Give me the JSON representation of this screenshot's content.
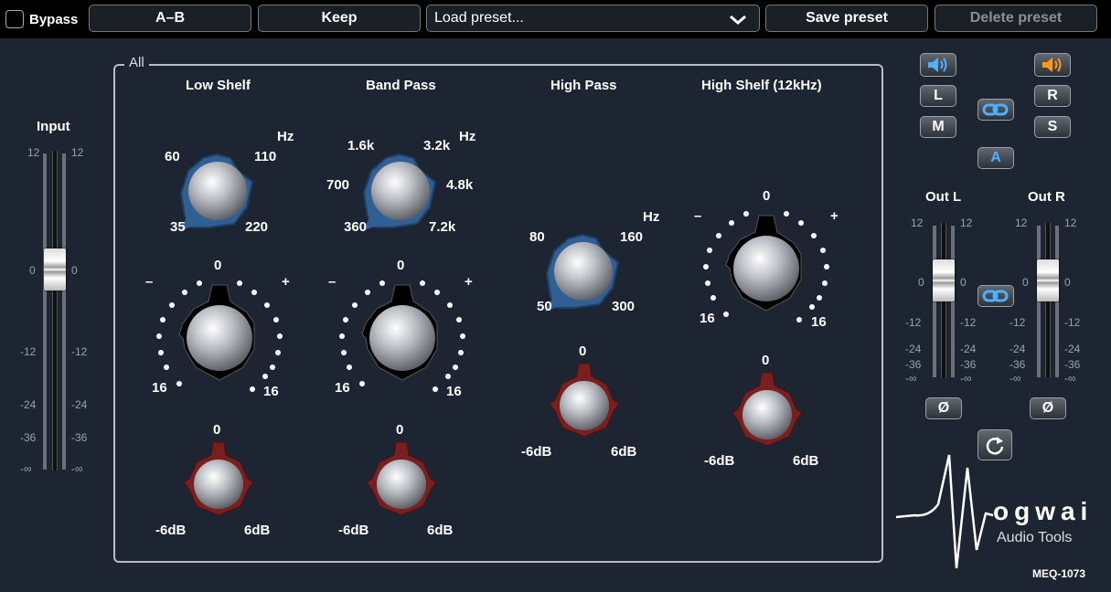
{
  "toolbar": {
    "bypass_label": "Bypass",
    "ab_label": "A–B",
    "keep_label": "Keep",
    "preset_value": "Load preset...",
    "save_label": "Save preset",
    "delete_label": "Delete preset"
  },
  "group": {
    "label": "All"
  },
  "input": {
    "label": "Input",
    "scale": [
      "12",
      "0",
      "-12",
      "-24",
      "-36",
      "-∞"
    ],
    "fader_db": 0
  },
  "bands": {
    "low_shelf": {
      "title": "Low Shelf",
      "unit": "Hz",
      "freqs": [
        "60",
        "110",
        "35",
        "220"
      ],
      "gain_top": "0",
      "gain_minus": "–",
      "gain_plus": "+",
      "gain_min": "16",
      "gain_max": "16",
      "trim_top": "0",
      "trim_min": "-6dB",
      "trim_max": "6dB"
    },
    "band_pass": {
      "title": "Band Pass",
      "unit": "Hz",
      "freqs": [
        "1.6k",
        "3.2k",
        "700",
        "4.8k",
        "360",
        "7.2k"
      ],
      "gain_top": "0",
      "gain_minus": "–",
      "gain_plus": "+",
      "gain_min": "16",
      "gain_max": "16",
      "trim_top": "0",
      "trim_min": "-6dB",
      "trim_max": "6dB"
    },
    "high_pass": {
      "title": "High Pass",
      "unit": "Hz",
      "freqs": [
        "80",
        "160",
        "50",
        "300"
      ],
      "trim_top": "0",
      "trim_min": "-6dB",
      "trim_max": "6dB"
    },
    "high_shelf": {
      "title": "High Shelf (12kHz)",
      "gain_top": "0",
      "gain_minus": "–",
      "gain_plus": "+",
      "gain_min": "16",
      "gain_max": "16",
      "trim_top": "0",
      "trim_min": "-6dB",
      "trim_max": "6dB"
    }
  },
  "routing": {
    "L": "L",
    "M": "M",
    "R": "R",
    "S": "S",
    "A": "A"
  },
  "outputs": {
    "out_l": "Out L",
    "out_r": "Out R",
    "scale": [
      "12",
      "0",
      "-12",
      "-24",
      "-36",
      "-∞"
    ],
    "phase_symbol": "Ø"
  },
  "brand": {
    "name": "ogwai",
    "sub": "Audio Tools",
    "model": "MEQ-1073"
  },
  "colors": {
    "bg": "#1d2532",
    "freq_ring": "#2f5f93",
    "trim_ring": "#7a1f1f",
    "speaker_left": "#4fb0ff",
    "speaker_right": "#ff9a1a"
  }
}
